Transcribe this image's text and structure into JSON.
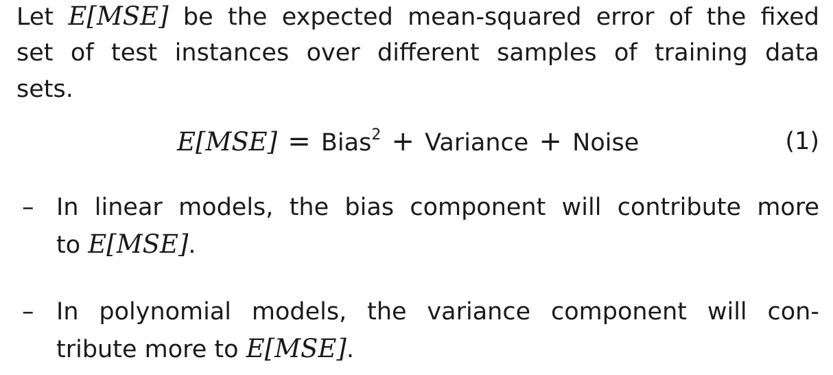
{
  "paragraph": {
    "line1_pre": "Let",
    "line1_math": "E[MSE]",
    "line1_post": "be the expected mean-squared error of the fixed",
    "line2": "set of test instances over different samples of training data",
    "line3": "sets."
  },
  "equation": {
    "lhs": "E[MSE]",
    "equals": "=",
    "term1": "Bias",
    "term1_sup": "2",
    "plus1": "+",
    "term2": "Variance",
    "plus2": "+",
    "term3": "Noise",
    "number": "(1)"
  },
  "bullets": [
    {
      "dash": "–",
      "line1": "In linear models, the bias component will contribute more",
      "line2_pre": "to",
      "line2_math": "E[MSE]",
      "line2_post": "."
    },
    {
      "dash": "–",
      "line1": "In polynomial models, the variance component will con-",
      "line2_pre": "tribute more to",
      "line2_math": "E[MSE]",
      "line2_post": "."
    }
  ]
}
